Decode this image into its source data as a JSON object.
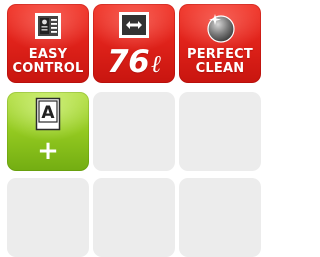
{
  "colors": {
    "red_tile": "#e1231b",
    "green_tile": "#93c920",
    "empty_tile": "#ececec"
  },
  "tiles": [
    {
      "name": "easy-control",
      "icon": "control-panel-icon",
      "line1": "EASY",
      "line2": "CONTROL"
    },
    {
      "name": "capacity",
      "icon": "capacity-gauge-icon",
      "value": "76",
      "unit": "ℓ"
    },
    {
      "name": "perfect-clean",
      "icon": "sparkle-sphere-icon",
      "line1": "PERFECT",
      "line2": "CLEAN"
    },
    {
      "name": "energy-class",
      "icon": "energy-label-icon",
      "letter": "A",
      "suffix": "+"
    }
  ]
}
